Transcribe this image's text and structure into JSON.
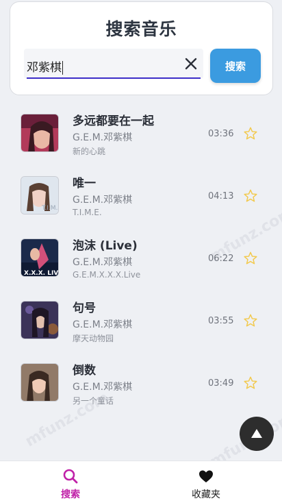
{
  "header": {
    "title": "搜索音乐",
    "search_value": "邓紫棋",
    "search_button": "搜索"
  },
  "songs": [
    {
      "title": "多远都要在一起",
      "artist": "G.E.M.邓紫棋",
      "album": "新的心跳",
      "duration": "03:36"
    },
    {
      "title": "唯一",
      "artist": "G.E.M.邓紫棋",
      "album": "T.I.M.E.",
      "duration": "04:13"
    },
    {
      "title": "泡沫 (Live)",
      "artist": "G.E.M.邓紫棋",
      "album": "G.E.M.X.X.X.Live",
      "duration": "06:22"
    },
    {
      "title": "句号",
      "artist": "G.E.M.邓紫棋",
      "album": "摩天动物园",
      "duration": "03:55"
    },
    {
      "title": "倒数",
      "artist": "G.E.M.邓紫棋",
      "album": "另一个童话",
      "duration": "03:49"
    }
  ],
  "nav": {
    "search_label": "搜索",
    "favorites_label": "收藏夹"
  },
  "watermark": "mfunz.com",
  "colors": {
    "accent_blue": "#3b9be0",
    "active_tab": "#c020a8",
    "input_underline": "#3c2cc8",
    "star": "#f2c94c"
  },
  "icons": {
    "clear": "close-icon",
    "favorite": "star-outline-icon",
    "scroll_top": "triangle-up-icon",
    "nav_search": "search-icon",
    "nav_favorites": "heart-icon"
  }
}
